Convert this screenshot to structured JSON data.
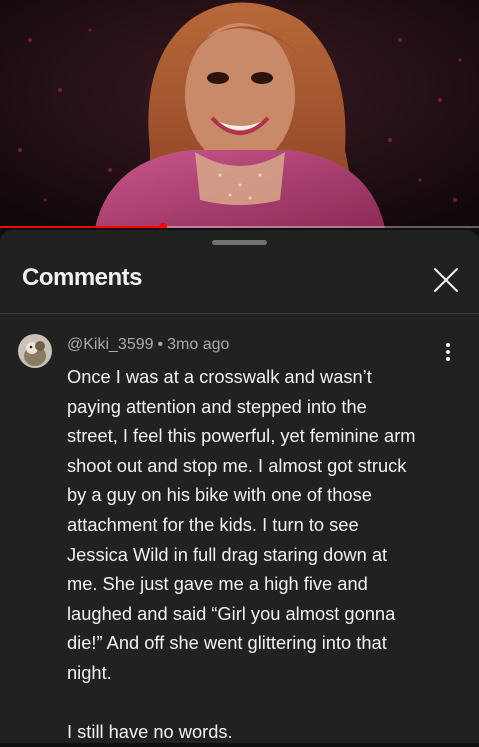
{
  "sheet": {
    "title": "Comments"
  },
  "video": {
    "progress": 0.34
  },
  "comment": {
    "author": "@Kiki_3599",
    "separator": "•",
    "time": "3mo ago",
    "lines": [
      "Once I was at a crosswalk and wasn’t",
      "paying attention and stepped into the",
      "street, I feel this powerful, yet feminine arm",
      "shoot out and stop me. I almost got struck",
      "by a guy on his bike with one of those",
      "attachment for the kids. I turn to see",
      "Jessica Wild in full drag staring down at",
      "me. She just gave me a high five and",
      "laughed and said “Girl you almost gonna",
      "die!” And off she went glittering into that",
      "night."
    ],
    "final_line": "I still have no words."
  },
  "icons": {
    "close": "close-icon",
    "more": "more-vert-icon",
    "drag": "drag-handle"
  }
}
